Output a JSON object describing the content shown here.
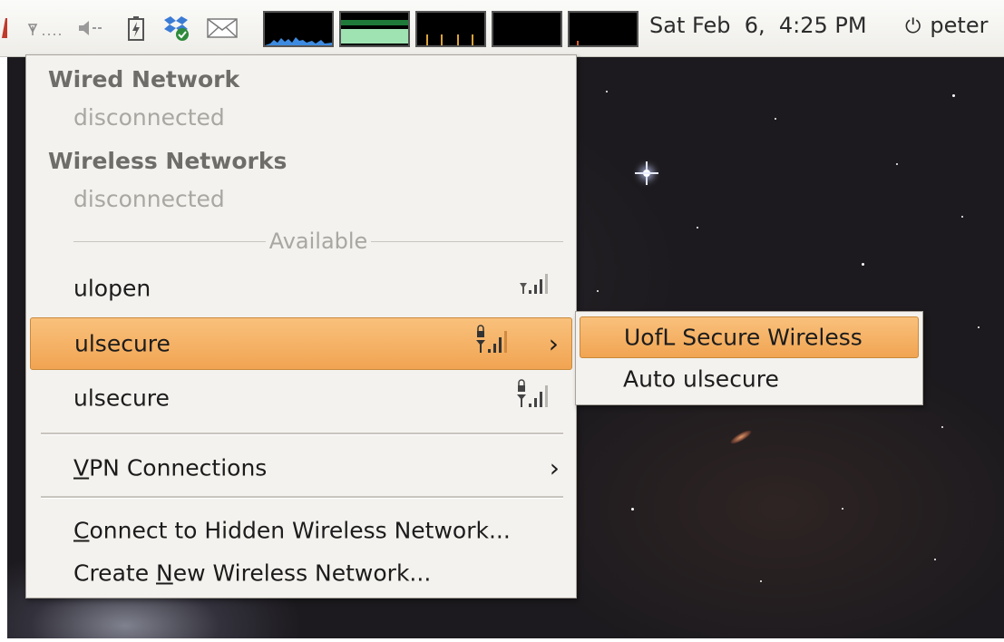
{
  "panel": {
    "clock": "Sat Feb  6,  4:25 PM",
    "user": "peter",
    "tray_icons": [
      "network-disconnected-icon",
      "volume-muted-icon",
      "battery-icon",
      "dropbox-icon",
      "mail-icon"
    ],
    "monitors": [
      "cpu-monitor",
      "memory-monitor",
      "network-monitor",
      "swap-monitor",
      "load-monitor"
    ]
  },
  "menu": {
    "wired_title": "Wired Network",
    "wired_status": "disconnected",
    "wireless_title": "Wireless Networks",
    "wireless_status": "disconnected",
    "available_label": "Available",
    "networks": [
      {
        "name": "ulopen",
        "secured": false,
        "has_submenu": false
      },
      {
        "name": "ulsecure",
        "secured": true,
        "has_submenu": true,
        "selected": true
      },
      {
        "name": "ulsecure",
        "secured": true,
        "has_submenu": false
      }
    ],
    "vpn_prefix": "V",
    "vpn_rest": "PN Connections",
    "hidden_prefix": "C",
    "hidden_rest": "onnect to Hidden Wireless Network...",
    "create_pre": "Create ",
    "create_u": "N",
    "create_rest": "ew Wireless Network..."
  },
  "submenu": {
    "items": [
      {
        "label": "UofL Secure Wireless",
        "selected": true
      },
      {
        "label": "Auto ulsecure",
        "selected": false
      }
    ]
  },
  "colors": {
    "highlight": "#f1a452",
    "menu_bg": "#f4f2ee"
  }
}
